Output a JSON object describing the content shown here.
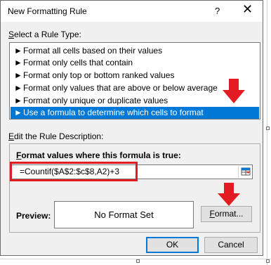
{
  "dialog": {
    "title": "New Formatting Rule",
    "help_label": "?",
    "close_label": "✕"
  },
  "rule_type": {
    "label_prefix": "",
    "label_key": "S",
    "label_rest": "elect a Rule Type:",
    "items": [
      {
        "label": "Format all cells based on their values"
      },
      {
        "label": "Format only cells that contain"
      },
      {
        "label": "Format only top or bottom ranked values"
      },
      {
        "label": "Format only values that are above or below average"
      },
      {
        "label": "Format only unique or duplicate values"
      },
      {
        "label": "Use a formula to determine which cells to format"
      }
    ],
    "selected_index": 5
  },
  "description": {
    "label_prefix": "",
    "label_key": "E",
    "label_rest": "dit the Rule Description:",
    "formula_label_key": "F",
    "formula_label_rest": "ormat values where this formula is true:",
    "formula_value": "=Countif($A$2:$c$8,A2)+3",
    "preview_label": "Preview:",
    "preview_text": "No Format Set",
    "format_button_key": "F",
    "format_button_rest": "ormat..."
  },
  "footer": {
    "ok_label": "OK",
    "cancel_label": "Cancel"
  },
  "colors": {
    "selection": "#0078d7",
    "annotation": "#e31b23"
  }
}
